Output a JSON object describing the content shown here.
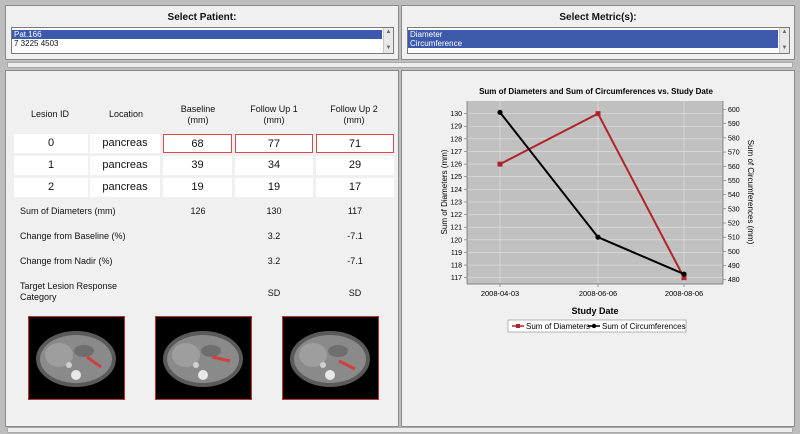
{
  "patient_selector": {
    "title": "Select Patient:",
    "items": [
      "Pat.166",
      "7 3225 4503"
    ],
    "selected_index": 0
  },
  "metric_selector": {
    "title": "Select Metric(s):",
    "items": [
      "Diameter",
      "Circumference"
    ],
    "selected": [
      0,
      1
    ]
  },
  "table": {
    "headers": {
      "lesion_id": "Lesion ID",
      "location": "Location",
      "baseline": "Baseline\n(mm)",
      "follow1": "Follow Up 1\n(mm)",
      "follow2": "Follow Up 2\n(mm)"
    },
    "rows": [
      {
        "id": "0",
        "location": "pancreas",
        "baseline": "68",
        "follow1": "77",
        "follow2": "71"
      },
      {
        "id": "1",
        "location": "pancreas",
        "baseline": "39",
        "follow1": "34",
        "follow2": "29"
      },
      {
        "id": "2",
        "location": "pancreas",
        "baseline": "19",
        "follow1": "19",
        "follow2": "17"
      }
    ],
    "summary": [
      {
        "label": "Sum of Diameters (mm)",
        "baseline": "126",
        "follow1": "130",
        "follow2": "117"
      },
      {
        "label": "Change from Baseline (%)",
        "baseline": "",
        "follow1": "3.2",
        "follow2": "-7.1"
      },
      {
        "label": "Change from Nadir (%)",
        "baseline": "",
        "follow1": "3.2",
        "follow2": "-7.1"
      },
      {
        "label": "Target Lesion Response\nCategory",
        "baseline": "",
        "follow1": "SD",
        "follow2": "SD"
      }
    ]
  },
  "chart_data": {
    "type": "line",
    "title": "Sum of Diameters and Sum of Circumferences vs. Study Date",
    "xlabel": "Study Date",
    "ylabel_left": "Sum of Diameters (mm)",
    "ylabel_right": "Sum of Circumferences (mm)",
    "categories": [
      "2008-04-03",
      "2008-06-06",
      "2008-08-06"
    ],
    "ylim_left": [
      116.5,
      131
    ],
    "yticks_left": [
      117,
      118,
      119,
      120,
      121,
      122,
      123,
      124,
      125,
      126,
      127,
      128,
      129,
      130
    ],
    "ylim_right": [
      477,
      606
    ],
    "yticks_right": [
      480,
      490,
      500,
      510,
      520,
      530,
      540,
      550,
      560,
      570,
      580,
      590,
      600
    ],
    "series": [
      {
        "name": "Sum of Diameters",
        "axis": "left",
        "color": "#b0252a",
        "marker": "square",
        "values": [
          126,
          130,
          117
        ]
      },
      {
        "name": "Sum of Circumferences",
        "axis": "right",
        "color": "#000000",
        "marker": "circle",
        "values": [
          598,
          510,
          484
        ]
      }
    ],
    "plot_background": "#c0c0c0",
    "grid": true,
    "legend": "bottom"
  }
}
